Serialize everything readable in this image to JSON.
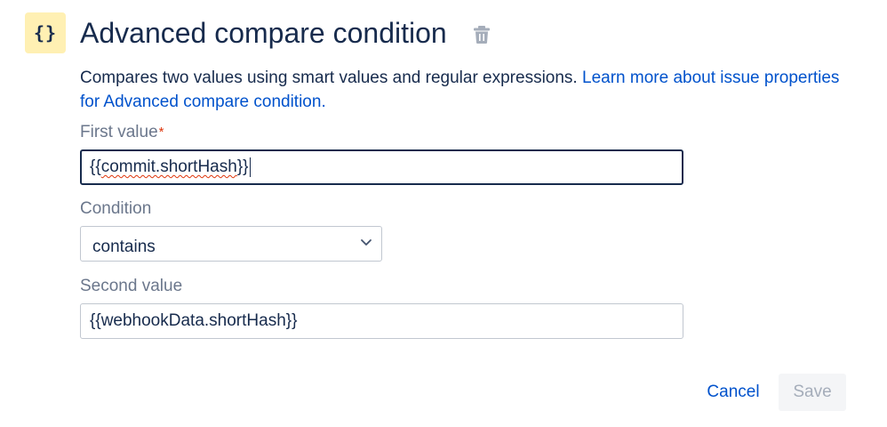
{
  "header": {
    "icon": "{}",
    "icon_name": "curly-braces-icon",
    "title": "Advanced compare condition",
    "delete_icon": "trash-icon"
  },
  "description": {
    "text": "Compares two values using smart values and regular expressions.",
    "link": "Learn more about issue properties for Advanced compare condition."
  },
  "fields": {
    "first_value": {
      "label": "First value",
      "required_marker": "*",
      "value_prefix": "{{",
      "value_misspelled": "commit.shortHash",
      "value_suffix": "}}"
    },
    "condition": {
      "label": "Condition",
      "selected": "contains"
    },
    "second_value": {
      "label": "Second value",
      "value": "{{webhookData.shortHash}}"
    }
  },
  "actions": {
    "cancel_label": "Cancel",
    "save_label": "Save"
  },
  "colors": {
    "link": "#0052cc",
    "icon_badge_bg": "#fff0b3",
    "required": "#de350b",
    "disabled_bg": "#f4f5f7",
    "disabled_text": "#a5adba"
  }
}
